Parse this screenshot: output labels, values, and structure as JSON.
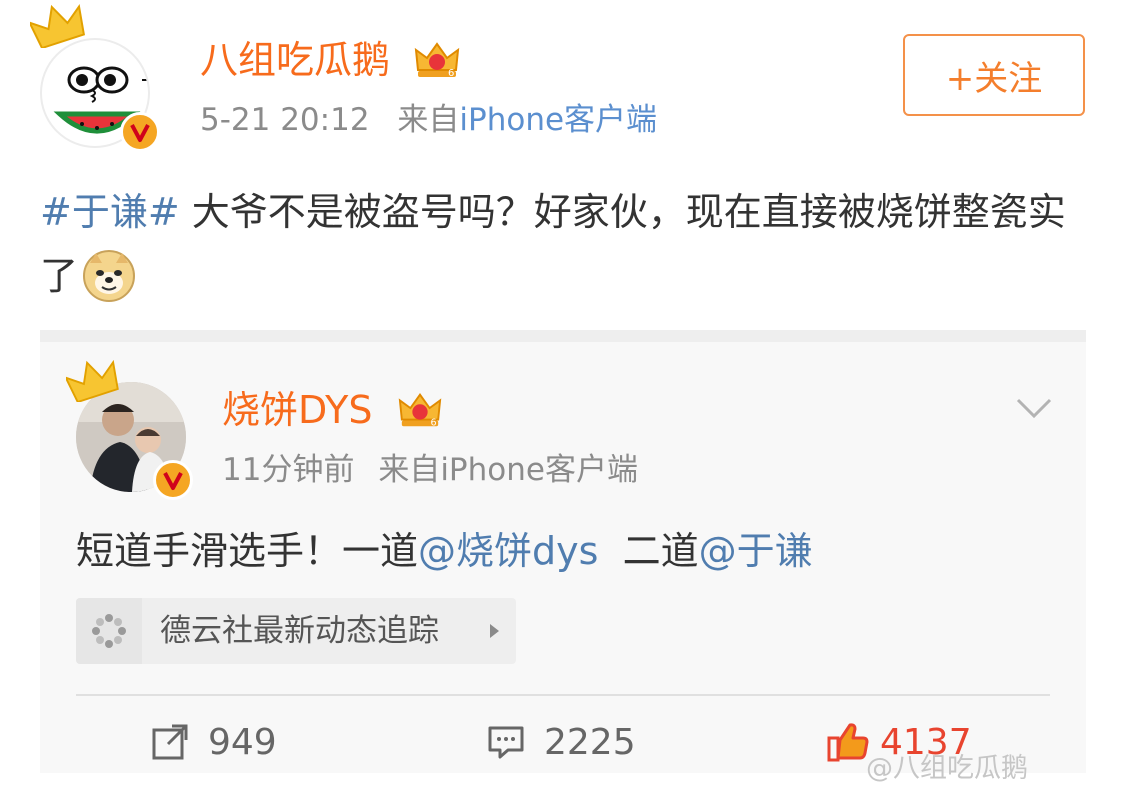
{
  "post": {
    "author": "八组吃瓜鹅",
    "time": "5-21 20:12",
    "source_prefix": "来自",
    "source": "iPhone客户端",
    "follow_label": "+关注",
    "hashtag": "#于谦#",
    "text": " 大爷不是被盗号吗？好家伙，现在直接被烧饼整瓷实了",
    "emoji": "doge-emoji"
  },
  "repost": {
    "author": "烧饼DYS",
    "time": "11分钟前",
    "source_prefix": "来自",
    "source": "iPhone客户端",
    "text_part1": "短道手滑选手！一道",
    "mention1": "@烧饼dys",
    "text_part2": "  二道",
    "mention2": "@于谦",
    "topic": "德云社最新动态追踪"
  },
  "actions": {
    "forward_count": "949",
    "comment_count": "2225",
    "like_count": "4137"
  },
  "watermark": "@八组吃瓜鹅",
  "colors": {
    "orange_name": "#f76b1c",
    "link_blue": "#507daf",
    "follow_border": "#f49149",
    "like_red": "#e8442f"
  }
}
